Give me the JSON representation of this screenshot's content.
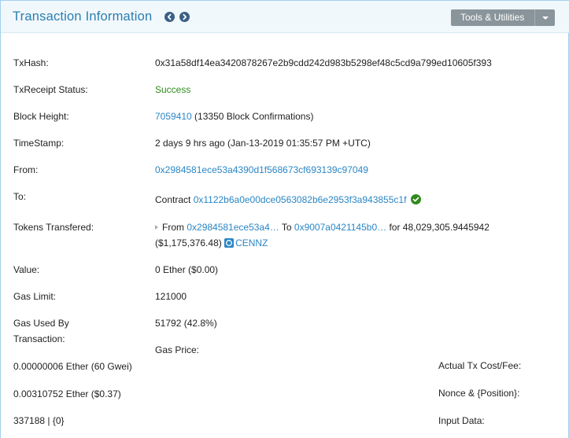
{
  "header": {
    "title": "Transaction Information",
    "tools_label": "Tools & Utilities"
  },
  "rows": {
    "txhash": {
      "label": "TxHash:",
      "value": "0x31a58df14ea3420878267e2b9cdd242d983b5298ef48c5cd9a799ed10605f393"
    },
    "status": {
      "label": "TxReceipt Status:",
      "value": "Success"
    },
    "block": {
      "label": "Block Height:",
      "block_link": "7059410",
      "confirmations": " (13350 Block Confirmations)"
    },
    "timestamp": {
      "label": "TimeStamp:",
      "value": "2 days 9 hrs ago (Jan-13-2019 01:35:57 PM +UTC)"
    },
    "from": {
      "label": "From:",
      "value": "0x2984581ece53a4390d1f568673cf693139c97049"
    },
    "to": {
      "label": "To:",
      "prefix": "Contract ",
      "address": "0x1122b6a0e00dce0563082b6e2953f3a943855c1f"
    },
    "tokens": {
      "label": "Tokens Transfered:",
      "from_prefix": "From ",
      "from_address": "0x2984581ece53a4…",
      "to_prefix": " To ",
      "to_address": "0x9007a0421145b0…",
      "for_text": " for  48,029,305.9445942",
      "usd_value": "($1,175,376.48)",
      "token_name": "CENNZ"
    },
    "value": {
      "label": "Value:",
      "value": "0 Ether ($0.00)"
    },
    "gas_limit": {
      "label": "Gas Limit:",
      "value": "121000"
    },
    "gas_used": {
      "label_line1": "Gas Used By",
      "label_line2": "Transaction:",
      "value": "51792 (42.8%)"
    },
    "gas_price": {
      "label": "Gas Price:"
    },
    "gas_price_value": "0.00000006 Ether (60 Gwei)",
    "actual_cost": {
      "label": "Actual Tx Cost/Fee:"
    },
    "actual_cost_value": "0.00310752 Ether ($0.37)",
    "nonce": {
      "label": "Nonce & {Position}:"
    },
    "nonce_value": "337188 | {0}",
    "input": {
      "label": "Input Data:"
    }
  },
  "icons": {
    "nav_prev": "chevron-left-circle",
    "nav_next": "chevron-right-circle",
    "verified": "check-circle",
    "token": "token-logo"
  },
  "colors": {
    "link": "#2a86c5",
    "success": "#2f8a1d",
    "title": "#2a7eb0",
    "header_bg": "#f1f8fc",
    "tools_bg": "#8a949b"
  }
}
